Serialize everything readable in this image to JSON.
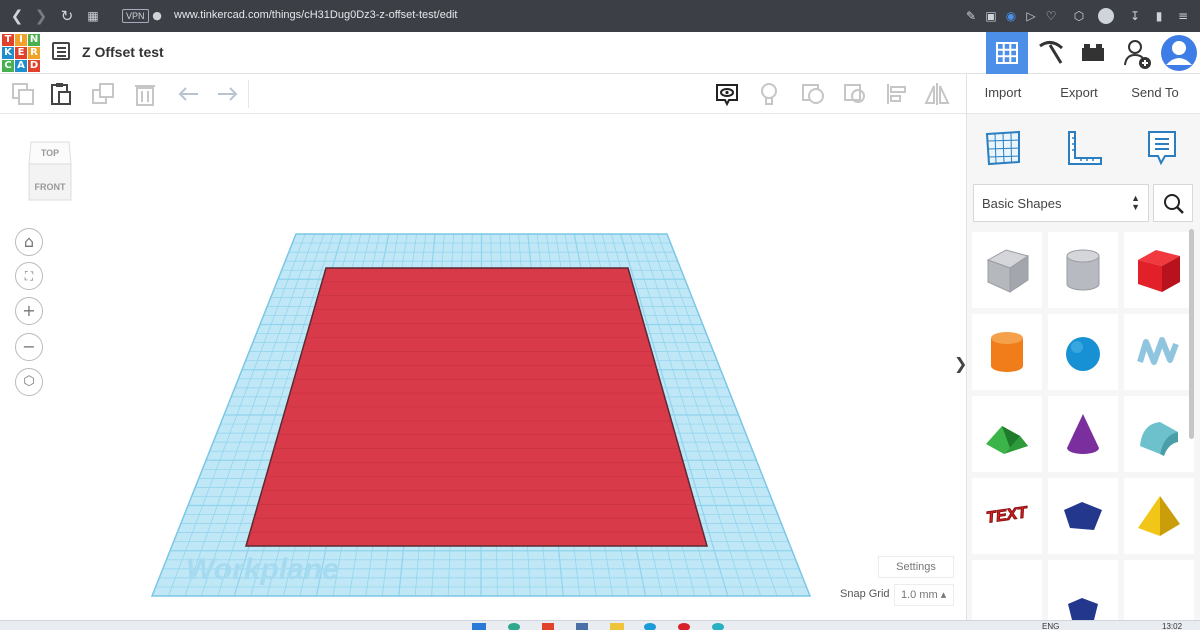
{
  "browser": {
    "vpn_label": "VPN",
    "url": "www.tinkercad.com/things/cH31Dug0Dz3-z-offset-test/edit"
  },
  "app": {
    "logo_letters": [
      "T",
      "I",
      "N",
      "K",
      "E",
      "R",
      "C",
      "A",
      "D"
    ],
    "logo_colors": [
      "#e2412b",
      "#f0a328",
      "#48b04f",
      "#1f8ece",
      "#e2412b",
      "#f0a328",
      "#48b04f",
      "#1f8ece",
      "#e2412b"
    ],
    "design_title": "Z Offset test",
    "accent_color": "#4b8fe8"
  },
  "toolbar": {
    "import_label": "Import",
    "export_label": "Export",
    "send_to_label": "Send To"
  },
  "viewcube": {
    "top_label": "TOP",
    "front_label": "FRONT"
  },
  "workplane": {
    "label": "Workplane",
    "grid_color": "#8fd3ee",
    "object_color": "#d83a4a"
  },
  "controls": {
    "settings_label": "Settings",
    "snap_grid_label": "Snap Grid",
    "snap_grid_value": "1.0 mm ▴"
  },
  "shapes_panel": {
    "category_label": "Basic Shapes",
    "shapes": [
      {
        "name": "box-hole",
        "color": "#b7bac0"
      },
      {
        "name": "cylinder-hole",
        "color": "#b7bac0"
      },
      {
        "name": "box",
        "color": "#e2202a"
      },
      {
        "name": "cylinder",
        "color": "#f07d1a"
      },
      {
        "name": "sphere",
        "color": "#1791d3"
      },
      {
        "name": "scribble",
        "color": "#8fc5de"
      },
      {
        "name": "roof",
        "color": "#2e9b3a"
      },
      {
        "name": "cone",
        "color": "#7b2e9e"
      },
      {
        "name": "round-roof",
        "color": "#6cc1cc"
      },
      {
        "name": "text",
        "color": "#d62323",
        "label": "TEXT"
      },
      {
        "name": "polygon",
        "color": "#23378c"
      },
      {
        "name": "pyramid",
        "color": "#f2c619"
      }
    ]
  },
  "taskbar": {
    "language": "ENG",
    "time": "13:02"
  }
}
